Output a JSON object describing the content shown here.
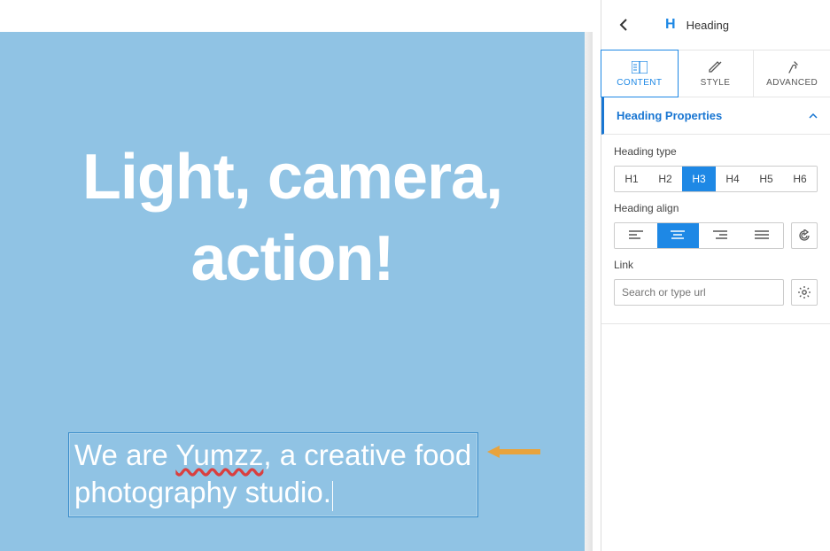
{
  "canvas": {
    "big_heading": "Light, camera, action!",
    "sub_part1": "We are ",
    "sub_underlined": "Yumzz",
    "sub_part2": ", a creative food photography studio."
  },
  "sidebar": {
    "title": "Heading",
    "tabs": {
      "content": "CONTENT",
      "style": "STYLE",
      "advanced": "ADVANCED"
    },
    "panel_title": "Heading Properties",
    "heading_type_label": "Heading type",
    "heading_types": [
      "H1",
      "H2",
      "H3",
      "H4",
      "H5",
      "H6"
    ],
    "heading_type_selected": "H3",
    "align_label": "Heading align",
    "link_label": "Link",
    "link_placeholder": "Search or type url"
  }
}
